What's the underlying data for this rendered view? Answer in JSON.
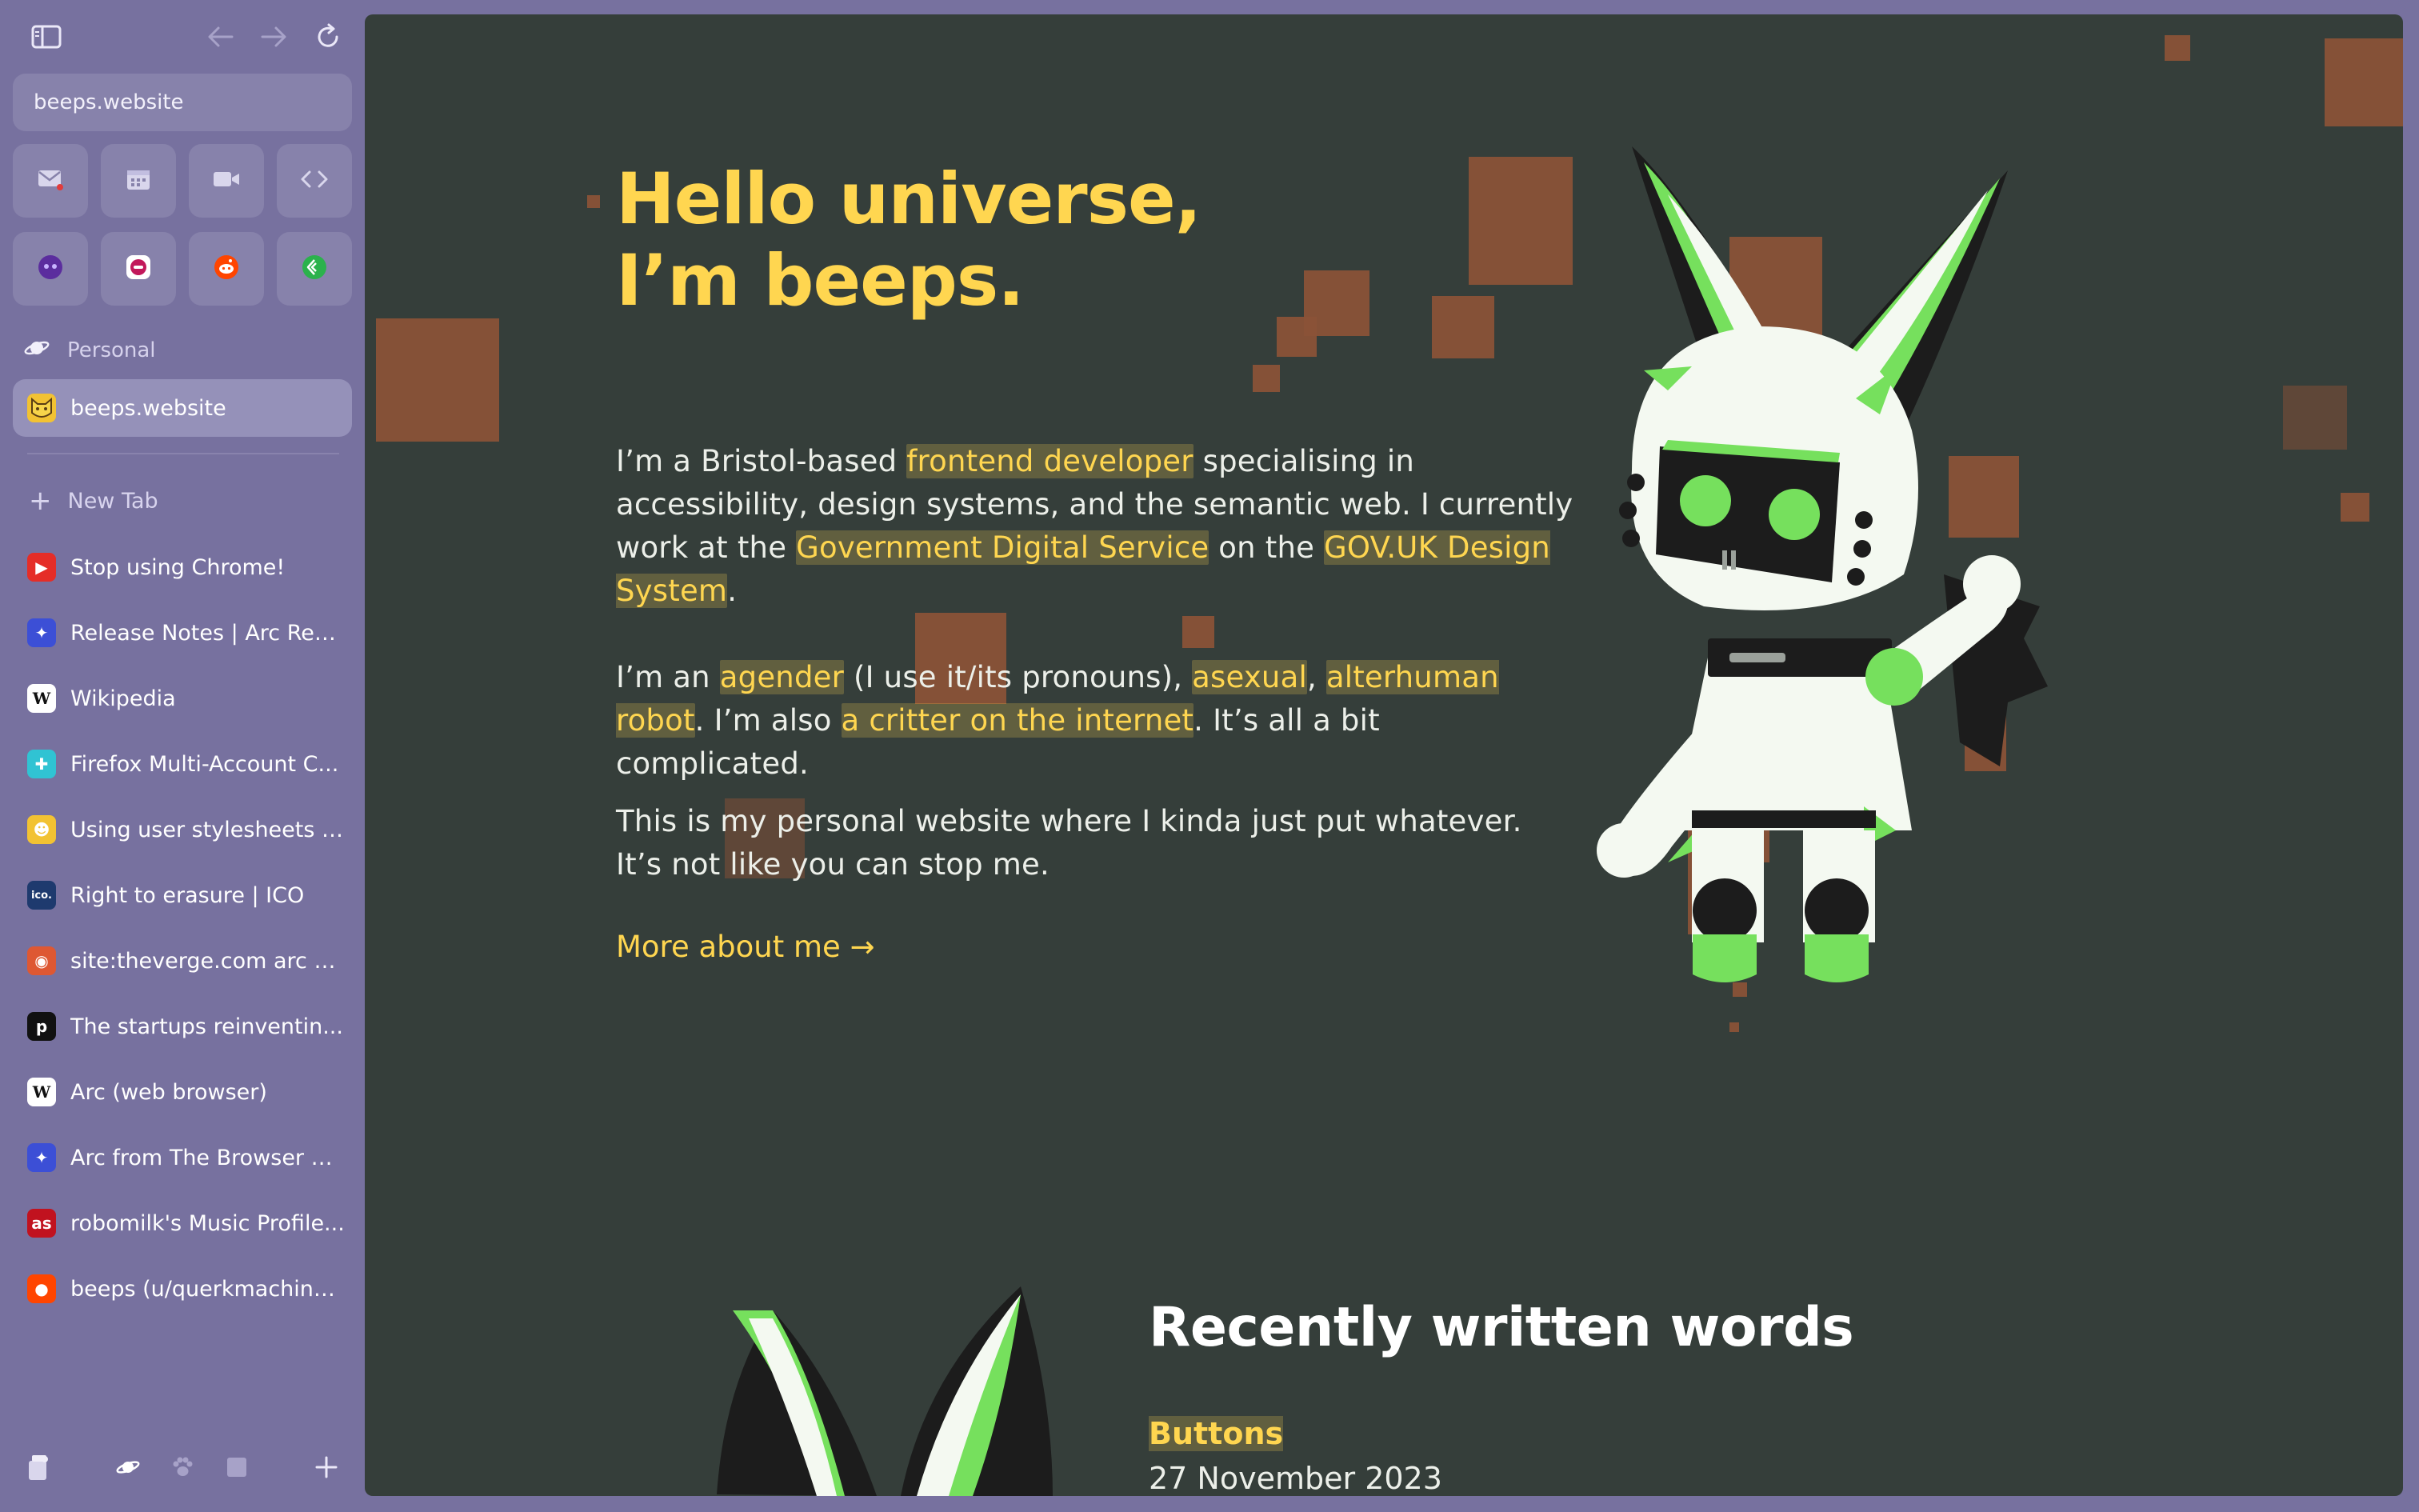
{
  "browser": {
    "url": "beeps.website",
    "space_label": "Personal",
    "new_tab_label": "New Tab",
    "pinned_tab": {
      "title": "beeps.website",
      "icon": "cat-icon"
    },
    "favorites_row1": [
      {
        "name": "mail-icon"
      },
      {
        "name": "calendar-icon"
      },
      {
        "name": "video-icon"
      },
      {
        "name": "code-icon"
      }
    ],
    "favorites_row2": [
      {
        "name": "mastodon-purple-icon"
      },
      {
        "name": "ghost-icon"
      },
      {
        "name": "reddit-icon"
      },
      {
        "name": "feedly-icon"
      }
    ],
    "tabs": [
      {
        "title": "Stop using Chrome!",
        "icon": "youtube-icon",
        "fav_bg": "#e52d27",
        "glyph": "▶"
      },
      {
        "title": "Release Notes | Arc Res...",
        "icon": "arc-icon",
        "fav_bg": "#3c4fd6",
        "glyph": "✦"
      },
      {
        "title": "Wikipedia",
        "icon": "wikipedia-icon",
        "fav_bg": "#ffffff",
        "glyph": "W"
      },
      {
        "title": "Firefox Multi-Account C...",
        "icon": "puzzle-icon",
        "fav_bg": "#30c3d3",
        "glyph": "✚"
      },
      {
        "title": "Using user stylesheets i...",
        "icon": "cat-icon",
        "fav_bg": "#f2c233",
        "glyph": "☻"
      },
      {
        "title": "Right to erasure | ICO",
        "icon": "ico-icon",
        "fav_bg": "#1e3a6e",
        "glyph": "ico."
      },
      {
        "title": "site:theverge.com arc b...",
        "icon": "duckduckgo-icon",
        "fav_bg": "#de5833",
        "glyph": "◉"
      },
      {
        "title": "The startups reinventin...",
        "icon": "protocol-icon",
        "fav_bg": "#111111",
        "glyph": "p"
      },
      {
        "title": "Arc (web browser)",
        "icon": "wikipedia-icon",
        "fav_bg": "#ffffff",
        "glyph": "W"
      },
      {
        "title": "Arc from The Browser C...",
        "icon": "arc-icon",
        "fav_bg": "#3c4fd6",
        "glyph": "✦"
      },
      {
        "title": "robomilk's Music Profile...",
        "icon": "lastfm-icon",
        "fav_bg": "#c1121f",
        "glyph": "as"
      },
      {
        "title": "beeps (u/querkmachine...",
        "icon": "reddit-icon",
        "fav_bg": "#ff4500",
        "glyph": "●"
      }
    ]
  },
  "page": {
    "hero_line1": "Hello universe,",
    "hero_line2": "I’m beeps.",
    "p1": {
      "t1": "I’m a Bristol-based ",
      "l1": "frontend developer",
      "t2": " specialising in accessibility, design systems, and the semantic web. I currently work at the ",
      "l2": "Government Digital Service",
      "t3": " on the ",
      "l3": "GOV.UK Design System",
      "t4": "."
    },
    "p2": {
      "t1": "I’m an ",
      "l1": "agender",
      "t2": " (I use it/its pronouns), ",
      "l2": "asexual",
      "t3": ", ",
      "l3": "alterhuman robot",
      "t4": ". I’m also ",
      "l4": "a critter on the internet",
      "t5": ". It’s all a bit complicated."
    },
    "p3": "This is my personal website where I kinda just put whatever. It’s not like you can stop me.",
    "more_link": "More about me →",
    "recent_heading": "Recently written words",
    "post_title": "Buttons",
    "post_date": "27 November 2023"
  },
  "colors": {
    "sidebar_bg": "#77719f",
    "page_bg": "#353e3a",
    "accent_yellow": "#ffd650",
    "robot_green": "#76e05d"
  }
}
